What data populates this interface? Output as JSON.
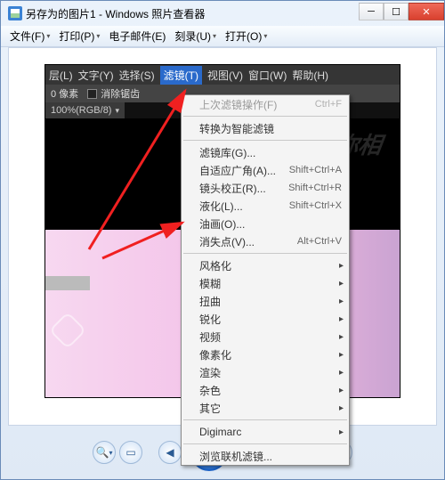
{
  "window": {
    "title": "另存为的图片1 - Windows 照片查看器"
  },
  "wpv_menu": [
    {
      "label": "文件(F)"
    },
    {
      "label": "打印(P)"
    },
    {
      "label": "电子邮件(E)"
    },
    {
      "label": "刻录(U)"
    },
    {
      "label": "打开(O)"
    }
  ],
  "ps_menu": [
    {
      "label": "层(L)"
    },
    {
      "label": "文字(Y)"
    },
    {
      "label": "选择(S)"
    },
    {
      "label": "滤镜(T)",
      "active": true
    },
    {
      "label": "视图(V)"
    },
    {
      "label": "窗口(W)"
    },
    {
      "label": "帮助(H)"
    }
  ],
  "ps_options": {
    "px_label": "0 像素",
    "clear_label": "消除锯齿"
  },
  "ps_status": {
    "zoom": "100%(RGB/8)"
  },
  "watermark": "天奇网与你相",
  "filter_menu": {
    "groups": [
      [
        {
          "label": "上次滤镜操作(F)",
          "shortcut": "Ctrl+F",
          "disabled": true
        }
      ],
      [
        {
          "label": "转换为智能滤镜"
        }
      ],
      [
        {
          "label": "滤镜库(G)..."
        },
        {
          "label": "自适应广角(A)...",
          "shortcut": "Shift+Ctrl+A"
        },
        {
          "label": "镜头校正(R)...",
          "shortcut": "Shift+Ctrl+R"
        },
        {
          "label": "液化(L)...",
          "shortcut": "Shift+Ctrl+X"
        },
        {
          "label": "油画(O)..."
        },
        {
          "label": "消失点(V)...",
          "shortcut": "Alt+Ctrl+V"
        }
      ],
      [
        {
          "label": "风格化",
          "submenu": true
        },
        {
          "label": "模糊",
          "submenu": true
        },
        {
          "label": "扭曲",
          "submenu": true
        },
        {
          "label": "锐化",
          "submenu": true
        },
        {
          "label": "视频",
          "submenu": true
        },
        {
          "label": "像素化",
          "submenu": true
        },
        {
          "label": "渲染",
          "submenu": true
        },
        {
          "label": "杂色",
          "submenu": true
        },
        {
          "label": "其它",
          "submenu": true
        }
      ],
      [
        {
          "label": "Digimarc",
          "submenu": true
        }
      ],
      [
        {
          "label": "浏览联机滤镜..."
        }
      ]
    ]
  }
}
